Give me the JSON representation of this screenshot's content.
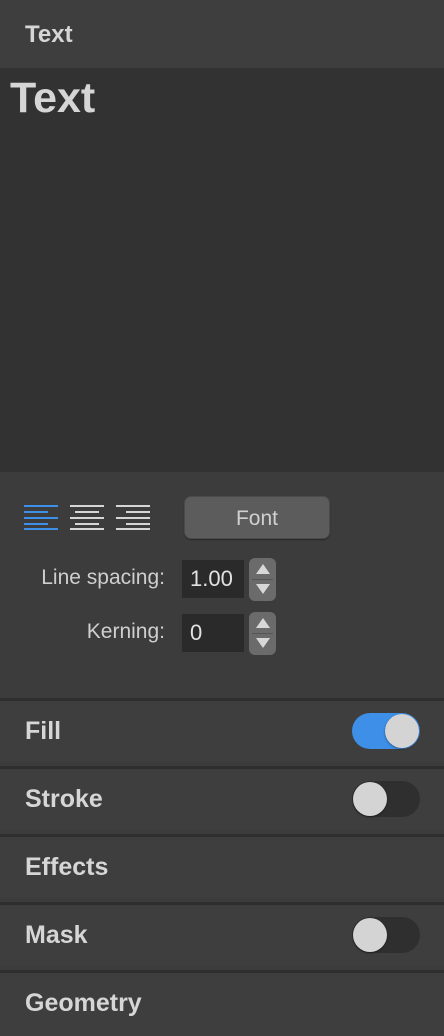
{
  "header": {
    "title": "Text"
  },
  "preview": {
    "text": "Text"
  },
  "alignment": {
    "options": [
      "align-left",
      "align-center",
      "align-right"
    ],
    "selected": "align-left",
    "active_color": "#3d8fe8",
    "inactive_color": "#d6d6d6"
  },
  "font_button": {
    "label": "Font"
  },
  "line_spacing": {
    "label": "Line spacing:",
    "value": "1.00"
  },
  "kerning": {
    "label": "Kerning:",
    "value": "0"
  },
  "sections": {
    "fill": {
      "title": "Fill",
      "toggle_on": true
    },
    "stroke": {
      "title": "Stroke",
      "toggle_on": false
    },
    "effects": {
      "title": "Effects"
    },
    "mask": {
      "title": "Mask",
      "toggle_on": false
    },
    "geometry": {
      "title": "Geometry"
    }
  },
  "colors": {
    "accent": "#3d8fe8",
    "panel": "#3c3c3c",
    "preview_bg": "#323232"
  }
}
